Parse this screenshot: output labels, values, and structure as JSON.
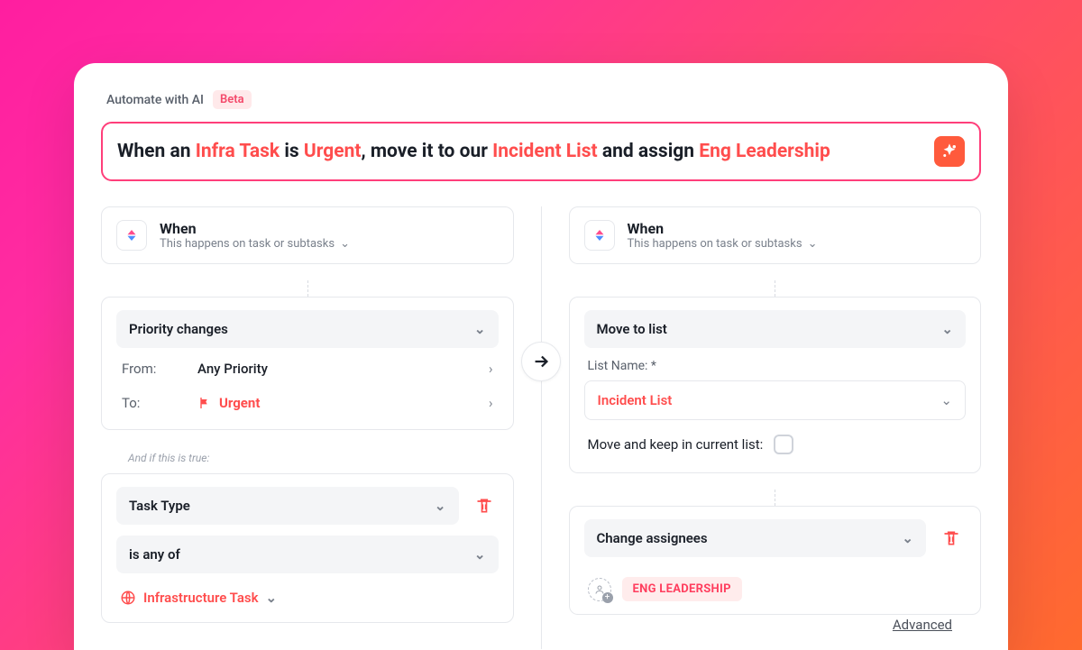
{
  "header": {
    "label": "Automate with AI",
    "beta": "Beta"
  },
  "prompt": {
    "p1": "When an ",
    "h1": "Infra Task",
    "p2": " is ",
    "h2": "Urgent",
    "p3": ", move it to our ",
    "h3": "Incident List",
    "p4": " and assign ",
    "h4": "Eng Leadership"
  },
  "left": {
    "when_title": "When",
    "when_sub": "This happens on task or subtasks",
    "trigger": "Priority changes",
    "from_label": "From:",
    "from_value": "Any Priority",
    "to_label": "To:",
    "to_value": "Urgent",
    "cond_note": "And if this is true:",
    "cond_field": "Task Type",
    "cond_op": "is any of",
    "cond_value": "Infrastructure Task"
  },
  "right": {
    "when_title": "When",
    "when_sub": "This happens on task or subtasks",
    "action1": "Move to list",
    "list_label": "List Name: *",
    "list_value": "Incident List",
    "keep_label": "Move and keep in current list:",
    "action2": "Change assignees",
    "assignee": "ENG LEADERSHIP",
    "advanced": "Advanced"
  }
}
